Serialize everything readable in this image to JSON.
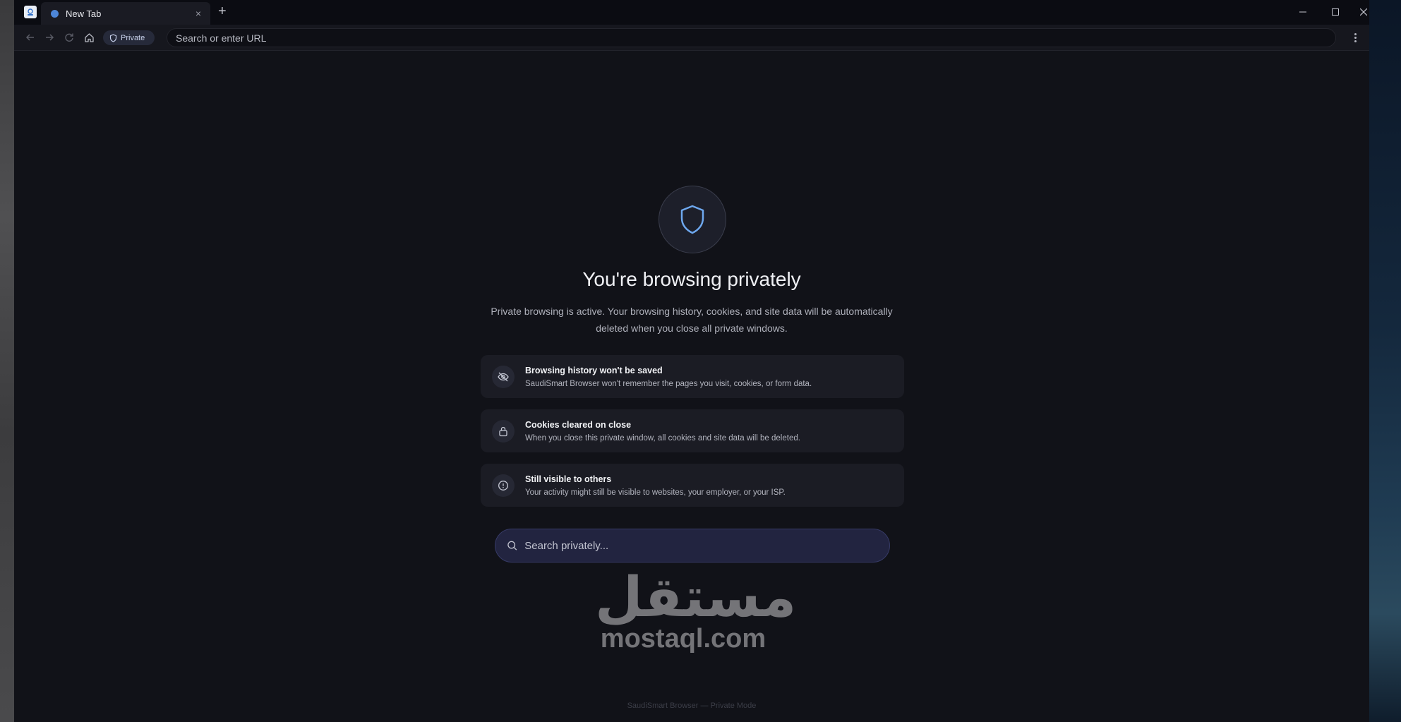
{
  "browser": {
    "tab": {
      "title": "New Tab",
      "close_glyph": "×"
    },
    "new_tab_glyph": "+",
    "window_controls": {
      "minimize": "–",
      "maximize": "☐",
      "close": "✕"
    }
  },
  "toolbar": {
    "private_label": "Private",
    "url_placeholder": "Search or enter URL"
  },
  "page": {
    "headline": "You're browsing privately",
    "description": "Private browsing is active. Your browsing history, cookies, and site data will be automatically deleted when you close all private windows.",
    "cards": [
      {
        "icon": "eye-off-icon",
        "title": "Browsing history won't be saved",
        "description": "SaudiSmart Browser won't remember the pages you visit, cookies, or form data."
      },
      {
        "icon": "lock-icon",
        "title": "Cookies cleared on close",
        "description": "When you close this private window, all cookies and site data will be deleted."
      },
      {
        "icon": "info-icon",
        "title": "Still visible to others",
        "description": "Your activity might still be visible to websites, your employer, or your ISP."
      }
    ],
    "search_placeholder": "Search privately...",
    "footer": "SaudiSmart Browser — Private Mode"
  },
  "watermark": {
    "arabic": "مستقل",
    "latin": "mostaql.com"
  },
  "colors": {
    "accent": "#4d86d8",
    "shield": "#6ea8ef",
    "background": "#111218"
  }
}
